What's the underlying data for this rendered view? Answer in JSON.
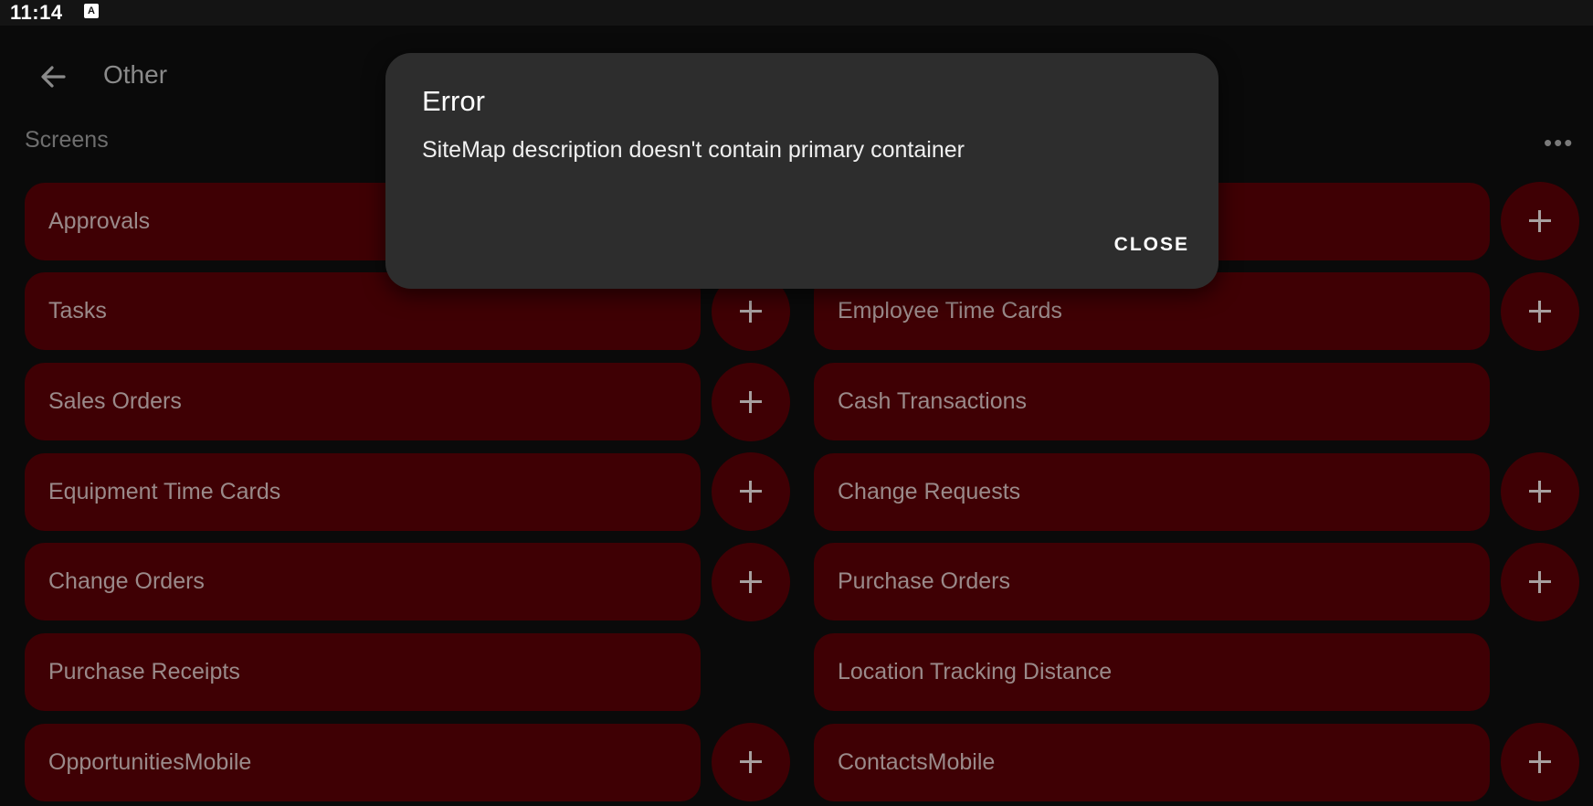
{
  "status_bar": {
    "time": "11:14",
    "notification_icon": "font-a-icon",
    "notification_glyph": "A"
  },
  "app_bar": {
    "back_icon": "arrow-back-icon",
    "title": "Other"
  },
  "section": {
    "title": "Screens",
    "more_icon": "more-horizontal-icon",
    "more_glyph": "•••"
  },
  "screens": {
    "approvals": "Approvals",
    "tasks": "Tasks",
    "employee_time_cards": "Employee Time Cards",
    "sales_orders": "Sales Orders",
    "cash_transactions": "Cash Transactions",
    "equipment_time_cards": "Equipment Time Cards",
    "change_requests": "Change Requests",
    "change_orders": "Change Orders",
    "purchase_orders": "Purchase Orders",
    "purchase_receipts": "Purchase Receipts",
    "location_tracking_distance": "Location Tracking Distance",
    "opportunities_mobile": "OpportunitiesMobile",
    "contacts_mobile": "ContactsMobile"
  },
  "dialog": {
    "title": "Error",
    "message": "SiteMap description doesn't contain primary container",
    "close_label": "CLOSE"
  },
  "colors": {
    "item_background": "#3f0004",
    "dialog_background": "#2d2d2d",
    "page_background": "#0a0a0a"
  }
}
